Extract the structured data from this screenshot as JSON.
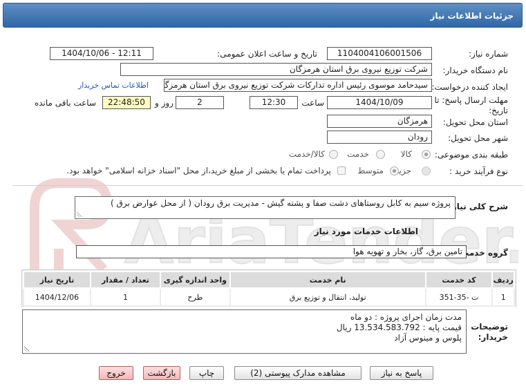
{
  "header": {
    "title": "جزئیات اطلاعات نیاز"
  },
  "fields": {
    "need_number_label": "شماره نیاز:",
    "need_number": "1104004106001506",
    "announce_label": "تاریخ و ساعت اعلان عمومی:",
    "announce_value": "1404/10/06 - 12:11",
    "buyer_org_label": "نام دستگاه خریدار:",
    "buyer_org": "شرکت توزیع نیروی برق استان هرمزگان",
    "requester_label": "ایجاد کننده درخواست:",
    "requester": "سیدحامد موسوی رئیس اداره تدارکات شرکت توزیع نیروی برق استان هرمزگان",
    "contact_link": "اطلاعات تماس خریدار",
    "deadline_label_1": "مهلت ارسال پاسخ: تا",
    "deadline_label_2": "تاریخ:",
    "deadline_date": "1404/10/09",
    "time_label": "ساعت",
    "deadline_time": "12:30",
    "days_value": "2",
    "days_label": "روز و",
    "remaining_time": "22:48:50",
    "remaining_label": "ساعت باقی مانده",
    "province_label": "استان محل تحویل:",
    "province": "هرمزگان",
    "city_label": "شهر محل تحویل:",
    "city": "رودان",
    "category_label": "طبقه بندی موضوعی:",
    "category_goods": "کالا",
    "category_service": "خدمت",
    "category_goods_service": "کالا/خدمت",
    "process_label": "نوع فرآیند خرید :",
    "process_partial": "جزیی",
    "process_medium": "متوسط",
    "process_note": "پرداخت تمام یا بخشی از مبلغ خرید،از محل \"اسناد خزانه اسلامی\" خواهد بود."
  },
  "description": {
    "label": "شرح کلی نیاز:",
    "text": "پروژه سیم به کابل روستاهای دشت صفا و پشته گیش - مدیریت برق رودان ( از محل عوارض برق )"
  },
  "services": {
    "section_title": "اطلاعات خدمات مورد نیاز",
    "group_label": "گروه خدمت:",
    "group_value": "تامین برق، گاز، بخار و تهویه هوا",
    "columns": [
      "ردیف",
      "کد خدمت",
      "نام خدمت",
      "واحد اندازه گیری",
      "تعداد / مقدار",
      "تاریخ نیاز"
    ],
    "rows": [
      [
        "1",
        "ت -35-351",
        "تولید، انتقال و توزیع برق",
        "طرح",
        "1",
        "1404/12/06"
      ]
    ]
  },
  "buyer_notes": {
    "label_1": "توضیحات",
    "label_2": "خریدار:",
    "line1": "مدت زمان اجرای پروژه : دو ماه",
    "line2": "قیمت پایه : 13.534.583.792 ریال",
    "line3": "پلوس و مینوس آزاد"
  },
  "buttons": {
    "reply": "پاسخ به نیاز",
    "attachments": "مشاهده مدارک پیوستی (2)",
    "print": "چاپ",
    "back": "بازگشت",
    "exit": "خروج"
  },
  "watermark": {
    "text": "AriaTender.net"
  }
}
